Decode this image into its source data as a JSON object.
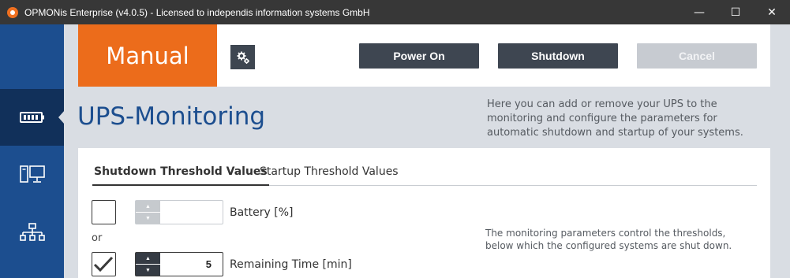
{
  "window": {
    "title": "OPMONis Enterprise (v4.0.5) - Licensed to independis information systems GmbH",
    "minimize_glyph": "—",
    "maximize_glyph": "☐",
    "close_glyph": "✕"
  },
  "sidebar": {
    "items": [
      {
        "name": "battery-icon",
        "active": true
      },
      {
        "name": "devices-icon",
        "active": false
      },
      {
        "name": "network-icon",
        "active": false
      }
    ]
  },
  "toolbar": {
    "mode_label": "Manual",
    "settings_icon": "gears-icon",
    "power_on_label": "Power On",
    "shutdown_label": "Shutdown",
    "cancel_label": "Cancel"
  },
  "page": {
    "title": "UPS-Monitoring",
    "description": "Here you can add or remove your UPS to the monitoring and configure the parameters for automatic shutdown and startup of your systems."
  },
  "tabs": [
    {
      "label": "Shutdown Threshold Values",
      "active": true
    },
    {
      "label": "Startup Threshold Values",
      "active": false
    }
  ],
  "thresholds": {
    "battery": {
      "label": "Battery [%]",
      "checked": false,
      "value": ""
    },
    "or_label": "or",
    "remaining_time": {
      "label": "Remaining Time [min]",
      "checked": true,
      "value": "5"
    },
    "hint": "The monitoring parameters control the thresholds, below which the configured systems are shut down."
  },
  "colors": {
    "brand_blue": "#1c4e8f",
    "sidebar_active": "#11305a",
    "mode_orange": "#ec6c1b",
    "button_dark": "#3e4651",
    "button_disabled": "#c7cbd1",
    "background": "#d9dde3"
  }
}
